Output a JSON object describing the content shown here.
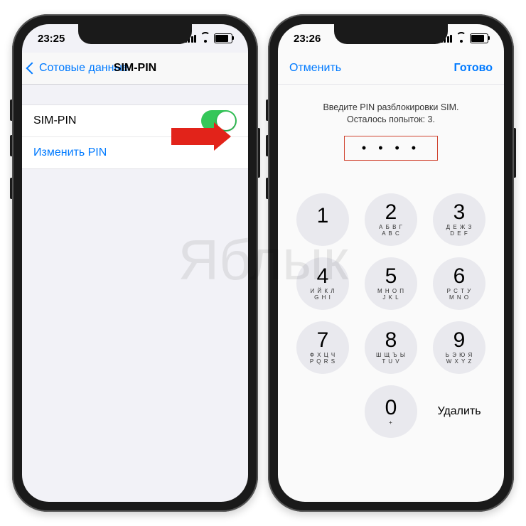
{
  "watermark": "Яблык",
  "left_phone": {
    "statusbar": {
      "time": "23:25"
    },
    "nav": {
      "back_label": "Сотовые данные",
      "title": "SIM-PIN"
    },
    "rows": {
      "sim_pin_label": "SIM-PIN",
      "sim_pin_on": true,
      "change_pin_label": "Изменить PIN"
    }
  },
  "right_phone": {
    "statusbar": {
      "time": "23:26"
    },
    "nav": {
      "cancel_label": "Отменить",
      "done_label": "Готово"
    },
    "message": "Введите PIN разблокировки SIM. Осталось попыток: 3.",
    "pin_dots": "• • • •",
    "keypad": [
      {
        "num": "1",
        "ru": "",
        "en": ""
      },
      {
        "num": "2",
        "ru": "А Б В Г",
        "en": "A B C"
      },
      {
        "num": "3",
        "ru": "Д Е Ж З",
        "en": "D E F"
      },
      {
        "num": "4",
        "ru": "И Й К Л",
        "en": "G H I"
      },
      {
        "num": "5",
        "ru": "М Н О П",
        "en": "J K L"
      },
      {
        "num": "6",
        "ru": "Р С Т У",
        "en": "M N O"
      },
      {
        "num": "7",
        "ru": "Ф Х Ц Ч",
        "en": "P Q R S"
      },
      {
        "num": "8",
        "ru": "Ш Щ Ъ Ы",
        "en": "T U V"
      },
      {
        "num": "9",
        "ru": "Ь Э Ю Я",
        "en": "W X Y Z"
      },
      {
        "num": "0",
        "ru": "+",
        "en": ""
      }
    ],
    "delete_label": "Удалить"
  }
}
